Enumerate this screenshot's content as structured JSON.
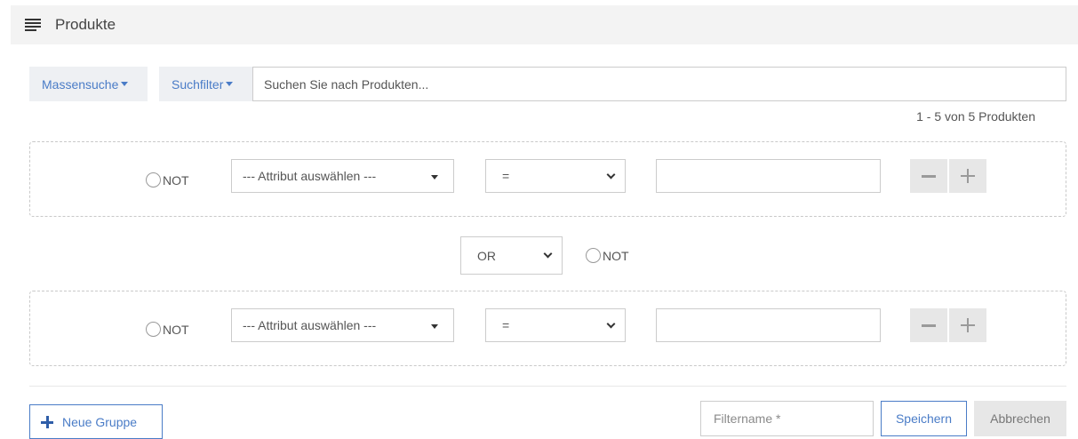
{
  "header": {
    "title": "Produkte",
    "icon": "menu-lines-icon"
  },
  "search": {
    "mass_label": "Massensuche",
    "filter_label": "Suchfilter",
    "placeholder": "Suchen Sie nach Produkten...",
    "value": ""
  },
  "result_count": "1 - 5 von 5 Produkten",
  "groups": [
    {
      "not_label": "NOT",
      "attribute": "--- Attribut auswählen ---",
      "operator": "=",
      "value": ""
    },
    {
      "not_label": "NOT",
      "attribute": "--- Attribut auswählen ---",
      "operator": "=",
      "value": ""
    }
  ],
  "connector": {
    "operator": "OR",
    "not_label": "NOT"
  },
  "footer": {
    "new_group_label": "Neue Gruppe",
    "filtername_placeholder": "Filtername *",
    "save_label": "Speichern",
    "cancel_label": "Abbrechen"
  },
  "colors": {
    "accent": "#4a7cc7",
    "header_bg": "#f3f3f3",
    "button_gray": "#e7e7e7"
  }
}
